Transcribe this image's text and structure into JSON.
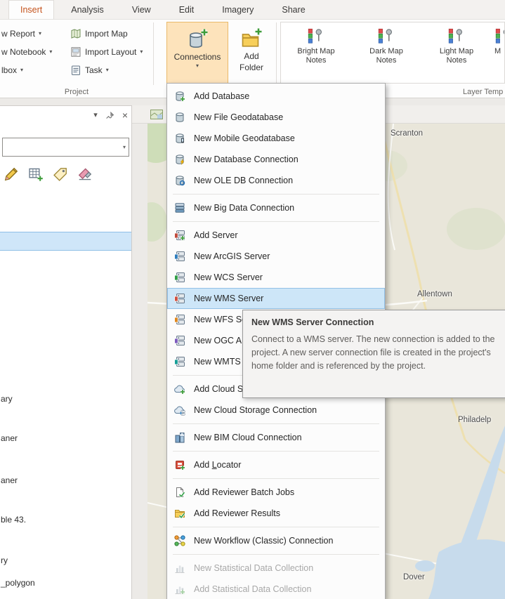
{
  "colors": {
    "accent": "#c5531c",
    "pressed-bg": "#fde3bb",
    "pressed-border": "#e9b96a",
    "selection": "#cfe6f9",
    "selection-border": "#8fbfe6",
    "menu-hl": "#cde6f8",
    "menu-hl-border": "#93c1e6",
    "disabled": "#a8a8a8",
    "land": "#e9e6da",
    "water": "#c7dbec",
    "green": "#cbdcb4"
  },
  "glyphs": {
    "caret": "▾",
    "close": "×"
  },
  "ribbon": {
    "tabs": [
      "Insert",
      "Analysis",
      "View",
      "Edit",
      "Imagery",
      "Share"
    ],
    "left_buttons": [
      "w Report",
      "w Notebook",
      "lbox"
    ],
    "mid_buttons": [
      "Import Map",
      "Import Layout",
      "Task"
    ],
    "connections_label": "Connections",
    "add_folder_line1": "Add",
    "add_folder_line2": "Folder",
    "gallery": [
      "Bright Map Notes",
      "Dark Map Notes",
      "Light Map Notes",
      "M"
    ],
    "group_project": "Project",
    "group_layer_templates": "Layer Temp"
  },
  "menu": {
    "items": [
      {
        "label": "Add Database",
        "icon": "database-add"
      },
      {
        "label": "New File Geodatabase",
        "icon": "file-geodatabase"
      },
      {
        "label": "New Mobile Geodatabase",
        "icon": "mobile-geodatabase"
      },
      {
        "label": "New Database Connection",
        "icon": "database-connection"
      },
      {
        "label": "New OLE DB Connection",
        "icon": "ole-db-connection"
      },
      {
        "label": "New Big Data Connection",
        "icon": "big-data-connection"
      },
      {
        "label": "Add Server",
        "icon": "server-add"
      },
      {
        "label": "New ArcGIS Server",
        "icon": "arcgis-server"
      },
      {
        "label": "New WCS Server",
        "icon": "wcs-server"
      },
      {
        "label": "New WMS Server",
        "icon": "wms-server",
        "highlighted": true
      },
      {
        "label": "New WFS Server",
        "icon": "wfs-server"
      },
      {
        "label": "New OGC API Server",
        "icon": "ogc-api-server"
      },
      {
        "label": "New WMTS Server",
        "icon": "wmts-server"
      },
      {
        "label": "Add Cloud Storage Connection",
        "icon": "cloud-storage-add"
      },
      {
        "label": "New Cloud Storage Connection",
        "icon": "cloud-storage-new"
      },
      {
        "label": "New BIM Cloud Connection",
        "icon": "bim-cloud"
      },
      {
        "label_pre": "Add ",
        "label_mn": "L",
        "label_post": "ocator",
        "icon": "locator-add"
      },
      {
        "label": "Add Reviewer Batch Jobs",
        "icon": "reviewer-batch-jobs"
      },
      {
        "label": "Add Reviewer Results",
        "icon": "reviewer-results"
      },
      {
        "label": "New Workflow (Classic) Connection",
        "icon": "workflow-classic"
      },
      {
        "label": "New Statistical Data Collection",
        "icon": "statistical-data-new",
        "disabled": true
      },
      {
        "label": "Add Statistical Data Collection",
        "icon": "statistical-data-add",
        "disabled": true
      }
    ]
  },
  "tooltip": {
    "title": "New WMS Server Connection",
    "body": "Connect to a WMS server. The new connection is added to the project. A new server connection file is created in the project's home folder and is referenced by the project."
  },
  "panel": {
    "search_value": "",
    "fragments": [
      "ary",
      "aner",
      "aner",
      "ble 43.",
      "ry",
      "_polygon"
    ]
  },
  "map": {
    "labels": [
      "Scranton",
      "Allentown",
      "Philadelp",
      "Dover"
    ]
  }
}
